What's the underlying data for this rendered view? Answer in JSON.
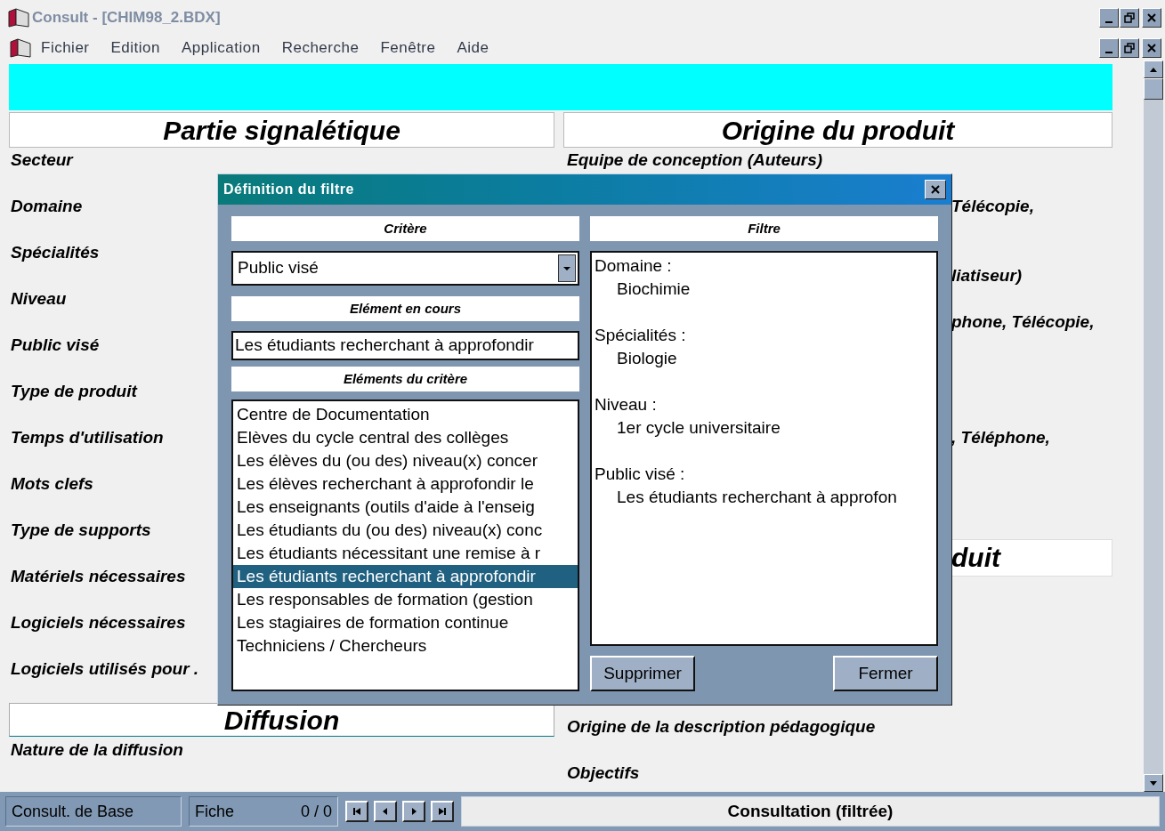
{
  "window": {
    "title": "Consult - [CHIM98_2.BDX]"
  },
  "menu": [
    {
      "label": "Fichier"
    },
    {
      "label": "Edition"
    },
    {
      "label": "Application"
    },
    {
      "label": "Recherche"
    },
    {
      "label": "Fenêtre"
    },
    {
      "label": "Aide"
    }
  ],
  "left_section": {
    "title": "Partie signalétique",
    "fields": [
      "Secteur",
      "Domaine",
      "Spécialités",
      "Niveau",
      "Public visé",
      "Type de produit",
      "Temps d'utilisation",
      "Mots clefs",
      "Type de supports",
      "Matériels nécessaires",
      "Logiciels nécessaires",
      "Logiciels utilisés pour ."
    ]
  },
  "diffusion_section": {
    "title": "Diffusion",
    "fields": [
      "Nature de la diffusion"
    ]
  },
  "right_section": {
    "title": "Origine du produit",
    "items": [
      {
        "kind": "label",
        "text": "Equipe de conception (Auteurs)"
      },
      {
        "kind": "label",
        "text": "Télécopie,"
      },
      {
        "kind": "label",
        "text": "liatiseur)"
      },
      {
        "kind": "label",
        "text": "phone, Télécopie,"
      },
      {
        "kind": "label",
        "text": ", Téléphone,"
      },
      {
        "kind": "header",
        "text": "duit"
      },
      {
        "kind": "label",
        "text": "Origine de la description pédagogique"
      },
      {
        "kind": "label",
        "text": "Objectifs"
      }
    ]
  },
  "dialog": {
    "title": "Définition du filtre",
    "criterion_header": "Critère",
    "criterion_value": "Public visé",
    "current_header": "Elément en cours",
    "current_value": "Les étudiants recherchant à approfondir",
    "elements_header": "Eléments du critère",
    "elements": [
      {
        "text": "Centre de Documentation",
        "selected": false
      },
      {
        "text": "Elèves du cycle central des collèges",
        "selected": false
      },
      {
        "text": "Les élèves du (ou des) niveau(x) concer",
        "selected": false
      },
      {
        "text": "Les élèves recherchant à approfondir le",
        "selected": false
      },
      {
        "text": "Les enseignants (outils d'aide à l'enseig",
        "selected": false
      },
      {
        "text": "Les étudiants du (ou des) niveau(x) conc",
        "selected": false
      },
      {
        "text": "Les étudiants nécessitant une remise à r",
        "selected": false
      },
      {
        "text": "Les étudiants recherchant à approfondir",
        "selected": true
      },
      {
        "text": "Les responsables de formation (gestion",
        "selected": false
      },
      {
        "text": "Les stagiaires de formation continue",
        "selected": false
      },
      {
        "text": "Techniciens / Chercheurs",
        "selected": false
      }
    ],
    "filter_header": "Filtre",
    "filter": [
      {
        "label": "Domaine :",
        "value": "Biochimie"
      },
      {
        "label": "Spécialités :",
        "value": "Biologie"
      },
      {
        "label": "Niveau :",
        "value": "1er cycle universitaire"
      },
      {
        "label": "Public visé :",
        "value": "Les étudiants recherchant à approfon"
      }
    ],
    "buttons": [
      {
        "label": "Supprimer"
      },
      {
        "label": "Fermer"
      }
    ]
  },
  "status_bar": {
    "mode": "Consult. de Base",
    "record_label": "Fiche",
    "record_count": "0 / 0",
    "status": "Consultation (filtrée)"
  }
}
